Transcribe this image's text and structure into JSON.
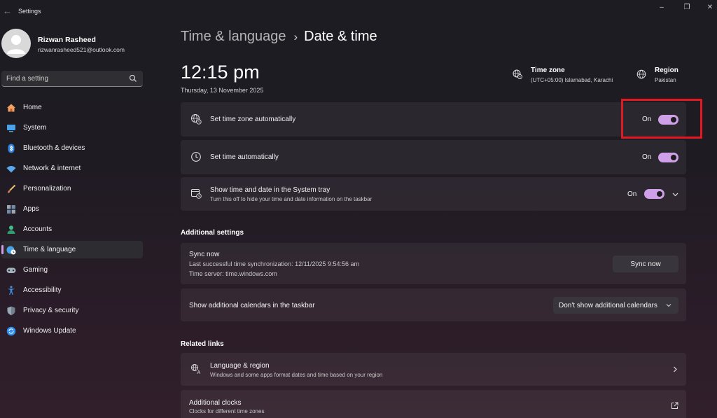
{
  "window": {
    "title": "Settings",
    "controls": {
      "minimize": "–",
      "maximize": "❐",
      "close": "✕"
    }
  },
  "profile": {
    "name": "Rizwan Rasheed",
    "email": "rizwanrasheed521@outlook.com"
  },
  "search": {
    "placeholder": "Find a setting"
  },
  "nav": [
    {
      "label": "Home",
      "icon": "home-icon",
      "active": false
    },
    {
      "label": "System",
      "icon": "system-icon",
      "active": false
    },
    {
      "label": "Bluetooth & devices",
      "icon": "bluetooth-icon",
      "active": false
    },
    {
      "label": "Network & internet",
      "icon": "wifi-icon",
      "active": false
    },
    {
      "label": "Personalization",
      "icon": "brush-icon",
      "active": false
    },
    {
      "label": "Apps",
      "icon": "apps-icon",
      "active": false
    },
    {
      "label": "Accounts",
      "icon": "account-icon",
      "active": false
    },
    {
      "label": "Time & language",
      "icon": "globe-clock-icon",
      "active": true
    },
    {
      "label": "Gaming",
      "icon": "gamepad-icon",
      "active": false
    },
    {
      "label": "Accessibility",
      "icon": "accessibility-icon",
      "active": false
    },
    {
      "label": "Privacy & security",
      "icon": "shield-icon",
      "active": false
    },
    {
      "label": "Windows Update",
      "icon": "update-icon",
      "active": false
    }
  ],
  "breadcrumb": {
    "parent": "Time & language",
    "separator": "›",
    "current": "Date & time"
  },
  "clock": {
    "time": "12:15 pm",
    "date": "Thursday, 13 November 2025"
  },
  "timezone_info": {
    "title": "Time zone",
    "value": "(UTC+05:00) Islamabad, Karachi"
  },
  "region_info": {
    "title": "Region",
    "value": "Pakistan"
  },
  "settings": {
    "tz_auto": {
      "title": "Set time zone automatically",
      "state": "On",
      "enabled": true
    },
    "time_auto": {
      "title": "Set time automatically",
      "state": "On",
      "enabled": true
    },
    "tray": {
      "title": "Show time and date in the System tray",
      "subtitle": "Turn this off to hide your time and date information on the taskbar",
      "state": "On",
      "enabled": true
    }
  },
  "additional": {
    "header": "Additional settings",
    "sync": {
      "title": "Sync now",
      "last_sync": "Last successful time synchronization: 12/11/2025 9:54:56 am",
      "server": "Time server: time.windows.com",
      "button": "Sync now"
    },
    "calendars": {
      "title": "Show additional calendars in the taskbar",
      "selected": "Don't show additional calendars"
    }
  },
  "related": {
    "header": "Related links",
    "language_region": {
      "title": "Language & region",
      "subtitle": "Windows and some apps format dates and time based on your region"
    },
    "clocks": {
      "title": "Additional clocks",
      "subtitle": "Clocks for different time zones"
    }
  },
  "colors": {
    "accent": "#cfa0e8",
    "highlight": "#e01a22",
    "background": "#1f1b23",
    "card": "#2a272d"
  }
}
